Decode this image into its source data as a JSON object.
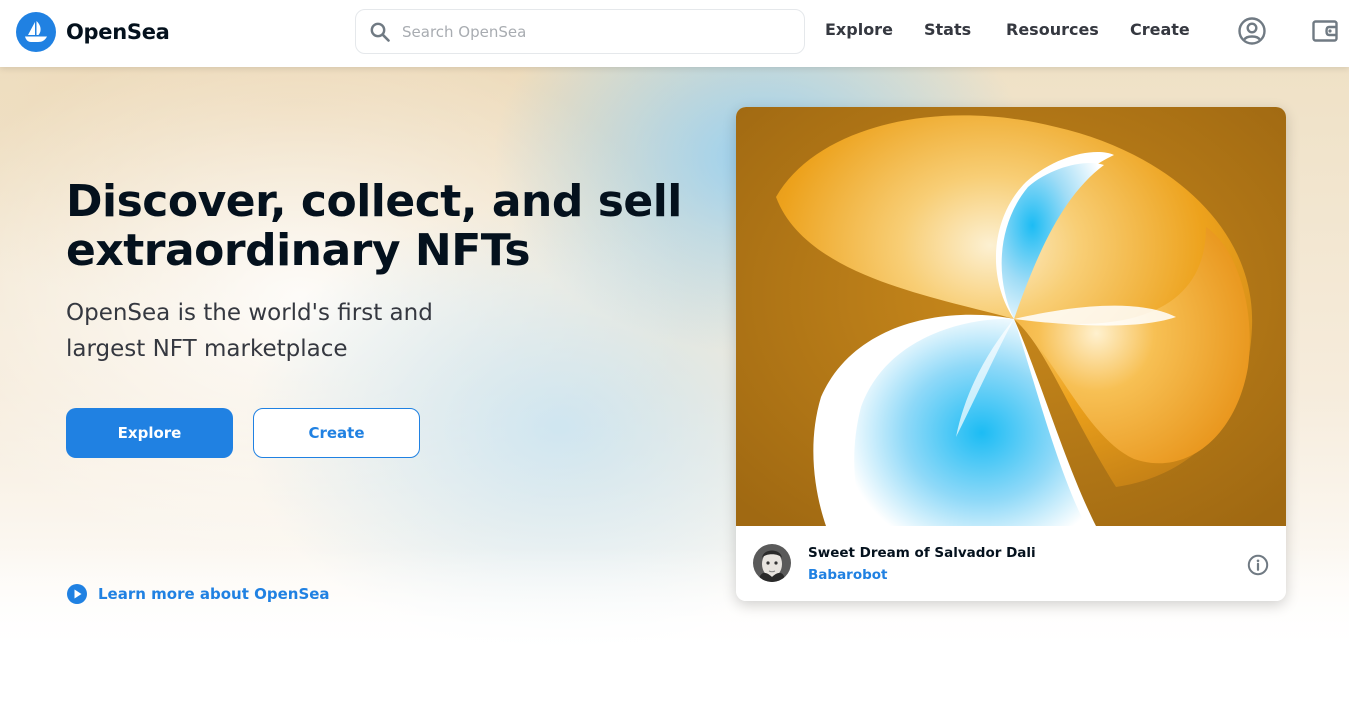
{
  "header": {
    "brand": "OpenSea",
    "search": {
      "placeholder": "Search OpenSea",
      "value": ""
    },
    "nav": [
      {
        "label": "Explore"
      },
      {
        "label": "Stats"
      },
      {
        "label": "Resources"
      },
      {
        "label": "Create"
      }
    ],
    "icons": [
      "opensea-logo-icon",
      "search-icon",
      "account-icon",
      "wallet-icon"
    ]
  },
  "hero": {
    "title": "Discover, collect, and sell extraordinary NFTs",
    "subtitle": "OpenSea is the world's first and largest NFT marketplace",
    "explore_label": "Explore",
    "create_label": "Create",
    "learn_more": "Learn more about OpenSea"
  },
  "featured": {
    "nft_name": "Sweet Dream of Salvador Dali",
    "creator": "Babarobot"
  },
  "colors": {
    "accent": "#2081e2",
    "text_dark": "#04111d",
    "text_gray": "#353840",
    "art_gold": "#f0a41c",
    "art_bronze": "#a86d14",
    "art_blue": "#1cbcf4"
  }
}
